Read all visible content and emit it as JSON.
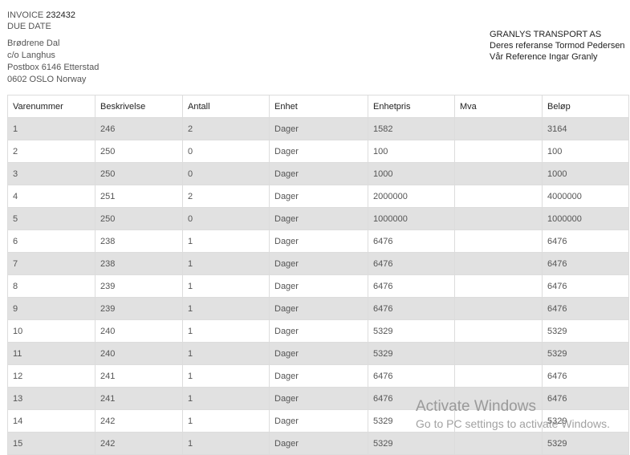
{
  "invoice": {
    "label": "INVOICE",
    "number": "232432",
    "due_date_label": "DUE DATE"
  },
  "customer": {
    "name": "Brødrene Dal",
    "co": "c/o Langhus",
    "address": "Postbox 6146 Etterstad",
    "city": "0602 OSLO Norway"
  },
  "company": {
    "name": "GRANLYS TRANSPORT AS",
    "their_ref": "Deres referanse Tormod Pedersen",
    "our_ref": "Vår Reference Ingar Granly"
  },
  "table": {
    "columns": [
      "Varenummer",
      "Beskrivelse",
      "Antall",
      "Enhet",
      "Enhetpris",
      "Mva",
      "Beløp"
    ],
    "rows": [
      [
        "1",
        "246",
        "2",
        "Dager",
        "1582",
        "",
        "3164"
      ],
      [
        "2",
        "250",
        "0",
        "Dager",
        "100",
        "",
        "100"
      ],
      [
        "3",
        "250",
        "0",
        "Dager",
        "1000",
        "",
        "1000"
      ],
      [
        "4",
        "251",
        "2",
        "Dager",
        "2000000",
        "",
        "4000000"
      ],
      [
        "5",
        "250",
        "0",
        "Dager",
        "1000000",
        "",
        "1000000"
      ],
      [
        "6",
        "238",
        "1",
        "Dager",
        "6476",
        "",
        "6476"
      ],
      [
        "7",
        "238",
        "1",
        "Dager",
        "6476",
        "",
        "6476"
      ],
      [
        "8",
        "239",
        "1",
        "Dager",
        "6476",
        "",
        "6476"
      ],
      [
        "9",
        "239",
        "1",
        "Dager",
        "6476",
        "",
        "6476"
      ],
      [
        "10",
        "240",
        "1",
        "Dager",
        "5329",
        "",
        "5329"
      ],
      [
        "11",
        "240",
        "1",
        "Dager",
        "5329",
        "",
        "5329"
      ],
      [
        "12",
        "241",
        "1",
        "Dager",
        "6476",
        "",
        "6476"
      ],
      [
        "13",
        "241",
        "1",
        "Dager",
        "6476",
        "",
        "6476"
      ],
      [
        "14",
        "242",
        "1",
        "Dager",
        "5329",
        "",
        "5329"
      ],
      [
        "15",
        "242",
        "1",
        "Dager",
        "5329",
        "",
        "5329"
      ]
    ]
  },
  "watermark": {
    "line1": "Activate Windows",
    "line2": "Go to PC settings to activate Windows."
  }
}
